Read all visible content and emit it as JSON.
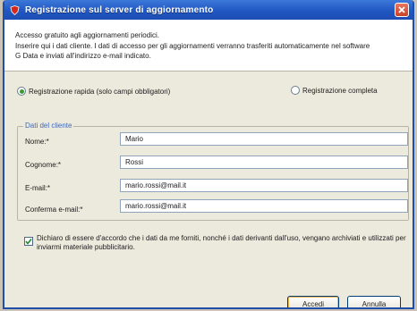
{
  "window": {
    "title": "Registrazione sul server di aggiornamento"
  },
  "intro": {
    "line1": "Accesso gratuito agli aggiornamenti periodici.",
    "line2": "Inserire qui i dati cliente. I dati di accesso per gli aggiornamenti verranno trasferiti automaticamente nel software G Data e inviati all'indirizzo e-mail indicato."
  },
  "registration_type": {
    "quick_label": "Registrazione rapida (solo campi obbligatori)",
    "quick_selected": true,
    "full_label": "Registrazione completa",
    "full_selected": false
  },
  "customer_data": {
    "group_title": "Dati del cliente",
    "fields": [
      {
        "label": "Nome:*",
        "value": "Mario"
      },
      {
        "label": "Cognome:*",
        "value": "Rossi"
      },
      {
        "label": "E-mail:*",
        "value": "mario.rossi@mail.it"
      },
      {
        "label": "Conferma e-mail:*",
        "value": "mario.rossi@mail.it"
      }
    ]
  },
  "consent": {
    "checked": true,
    "text": "Dichiaro di essere d'accordo che i dati da me forniti, nonché i dati derivanti dall'uso, vengano archiviati e utilizzati per inviarmi materiale pubblicitario."
  },
  "buttons": {
    "ok_label": "Accedi",
    "cancel_label": "Annulla"
  },
  "colors": {
    "titlebar": "#2157c2",
    "group_title": "#3f68b8",
    "radio_selected": "#3d9a3a"
  }
}
